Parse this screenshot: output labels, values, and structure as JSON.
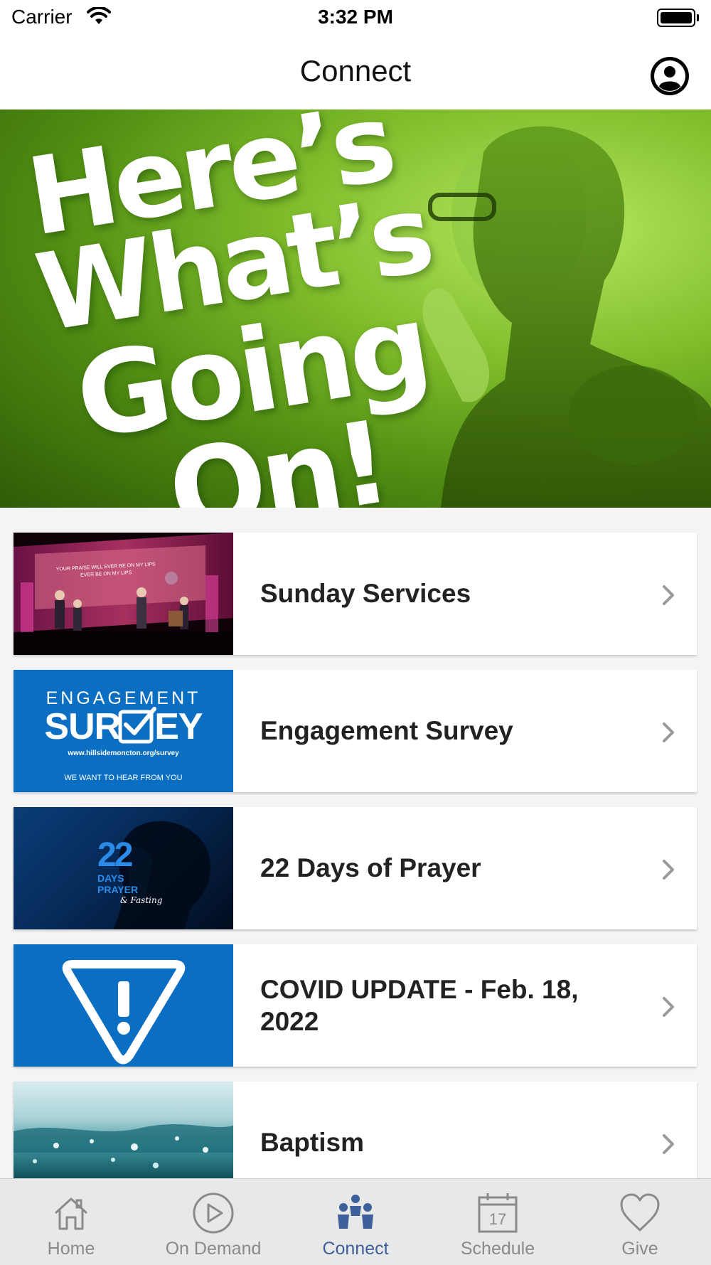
{
  "status_bar": {
    "carrier": "Carrier",
    "time": "3:32 PM"
  },
  "header": {
    "title": "Connect"
  },
  "hero": {
    "lines": [
      "Here’s",
      "What’s",
      "Going",
      "On!"
    ]
  },
  "items": [
    {
      "title": "Sunday Services",
      "screen_text": "YOUR PRAISE WILL EVER BE ON MY LIPS\nEVER BE ON MY LIPS"
    },
    {
      "title": "Engagement Survey",
      "thumb": {
        "top": "ENGAGEMENT",
        "big_left": "SUR",
        "big_right": "EY",
        "url": "www.hillsidemoncton.org/survey",
        "tagline": "WE WANT TO HEAR FROM YOU"
      }
    },
    {
      "title": "22 Days of Prayer",
      "thumb": {
        "number": "22",
        "line1": "DAYS",
        "line2": "PRAYER",
        "script": "& Fasting"
      }
    },
    {
      "title": "COVID UPDATE - Feb. 18, 2022"
    },
    {
      "title": "Baptism"
    }
  ],
  "tabs": [
    {
      "label": "Home",
      "icon": "house-icon",
      "active": false
    },
    {
      "label": "On Demand",
      "icon": "play-circle-icon",
      "active": false
    },
    {
      "label": "Connect",
      "icon": "people-icon",
      "active": true
    },
    {
      "label": "Schedule",
      "icon": "calendar-icon",
      "active": false,
      "calendar_day": "17"
    },
    {
      "label": "Give",
      "icon": "heart-icon",
      "active": false
    }
  ],
  "colors": {
    "active_tab": "#3d5f9a",
    "inactive_tab": "#8a8a8a",
    "hero_green": "#7dbb2a",
    "brand_blue": "#0a6fc2"
  }
}
